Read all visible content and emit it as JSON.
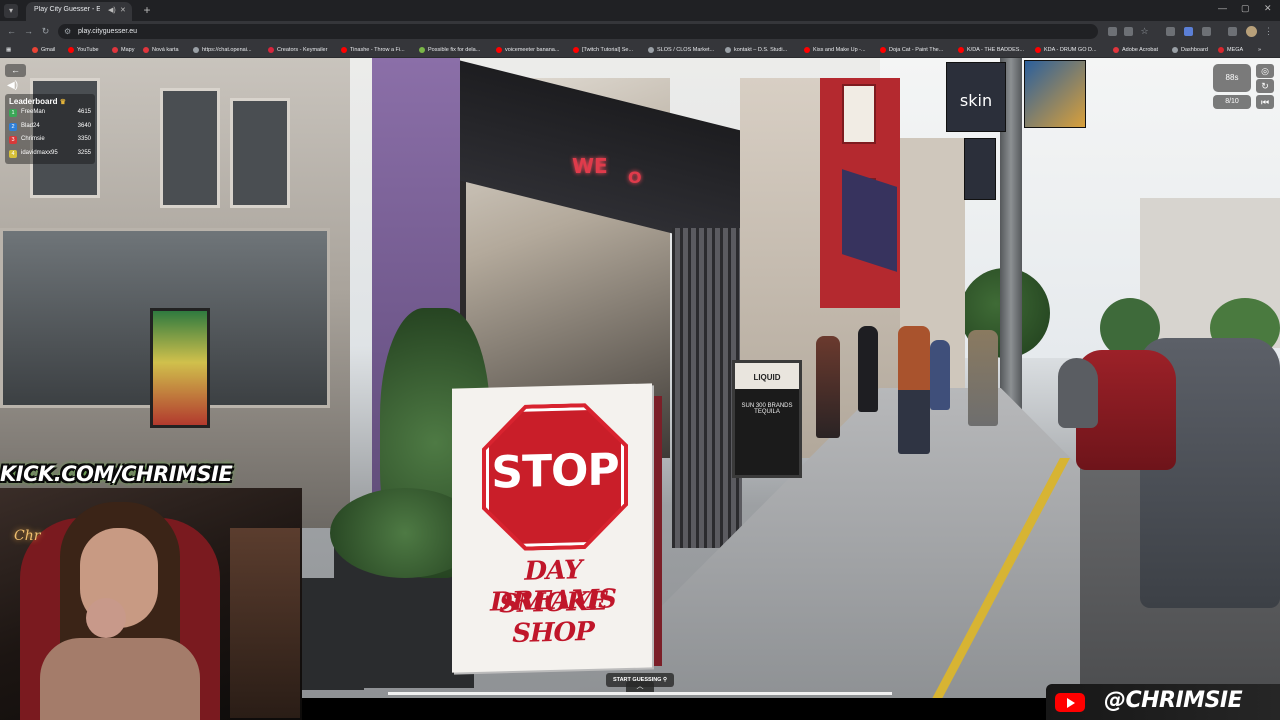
{
  "browser": {
    "tab_title": "Play City Guesser - Explore",
    "url": "play.cityguesser.eu",
    "bookmarks": [
      {
        "label": "Gmail",
        "color": "#ea4335"
      },
      {
        "label": "YouTube",
        "color": "#ff0000"
      },
      {
        "label": "Mapy",
        "color": "#e0353d"
      },
      {
        "label": "Nová karta",
        "color": "#e0353d"
      },
      {
        "label": "https://chat.openai...",
        "color": "#9aa0a6"
      },
      {
        "label": "Creators - Keymailer",
        "color": "#d7263d"
      },
      {
        "label": "Tinashe - Throw a Fi...",
        "color": "#ff0000"
      },
      {
        "label": "Possible fix for dela...",
        "color": "#7ab648"
      },
      {
        "label": "voicemeeter banana...",
        "color": "#ff0000"
      },
      {
        "label": "[Twitch Tutorial] Se...",
        "color": "#ff0000"
      },
      {
        "label": "SLOS / CLOS Market...",
        "color": "#9aa0a6"
      },
      {
        "label": "kontakt – D.S. Studi...",
        "color": "#9aa0a6"
      },
      {
        "label": "Kiss and Make Up -...",
        "color": "#ff0000"
      },
      {
        "label": "Doja Cat - Paint The...",
        "color": "#ff0000"
      },
      {
        "label": "K/DA - THE BADDES...",
        "color": "#ff0000"
      },
      {
        "label": "KDA - DRUM GO D...",
        "color": "#ff0000"
      },
      {
        "label": "Adobe Acrobat",
        "color": "#e0353d"
      },
      {
        "label": "Dashboard",
        "color": "#9aa0a6"
      },
      {
        "label": "MEGA",
        "color": "#d9272e"
      }
    ]
  },
  "hud": {
    "leaderboard_title": "Leaderboard",
    "leaderboard": [
      {
        "rank": "1",
        "name": "FreeMan",
        "score": "4615",
        "color": "#3aa757"
      },
      {
        "rank": "2",
        "name": "Blad24",
        "score": "3640",
        "color": "#2f7fd8"
      },
      {
        "rank": "3",
        "name": "Chrimsie",
        "score": "3350",
        "color": "#d63a3a"
      },
      {
        "rank": "4",
        "name": "idavidmaxx95",
        "score": "3255",
        "color": "#d6c03a"
      }
    ],
    "timer": "88s",
    "round": "8/10",
    "start_guessing": "START GUESSING"
  },
  "scene": {
    "sign_stop": "STOP",
    "sign_line1": "DAY DREAMS",
    "sign_line2": "SMOKE SHOP",
    "neon_left": "WE",
    "neon_right": "O",
    "banner_text": "skin",
    "chalkboard_title": "LIQUID",
    "chalkboard_line": "SUN 300 BRANDS TEQUILA"
  },
  "stream": {
    "kick_handle": "KICK.COM/CHRIMSIE",
    "youtube_handle": "@CHRIMSIE",
    "cam_sign": "Chr"
  }
}
